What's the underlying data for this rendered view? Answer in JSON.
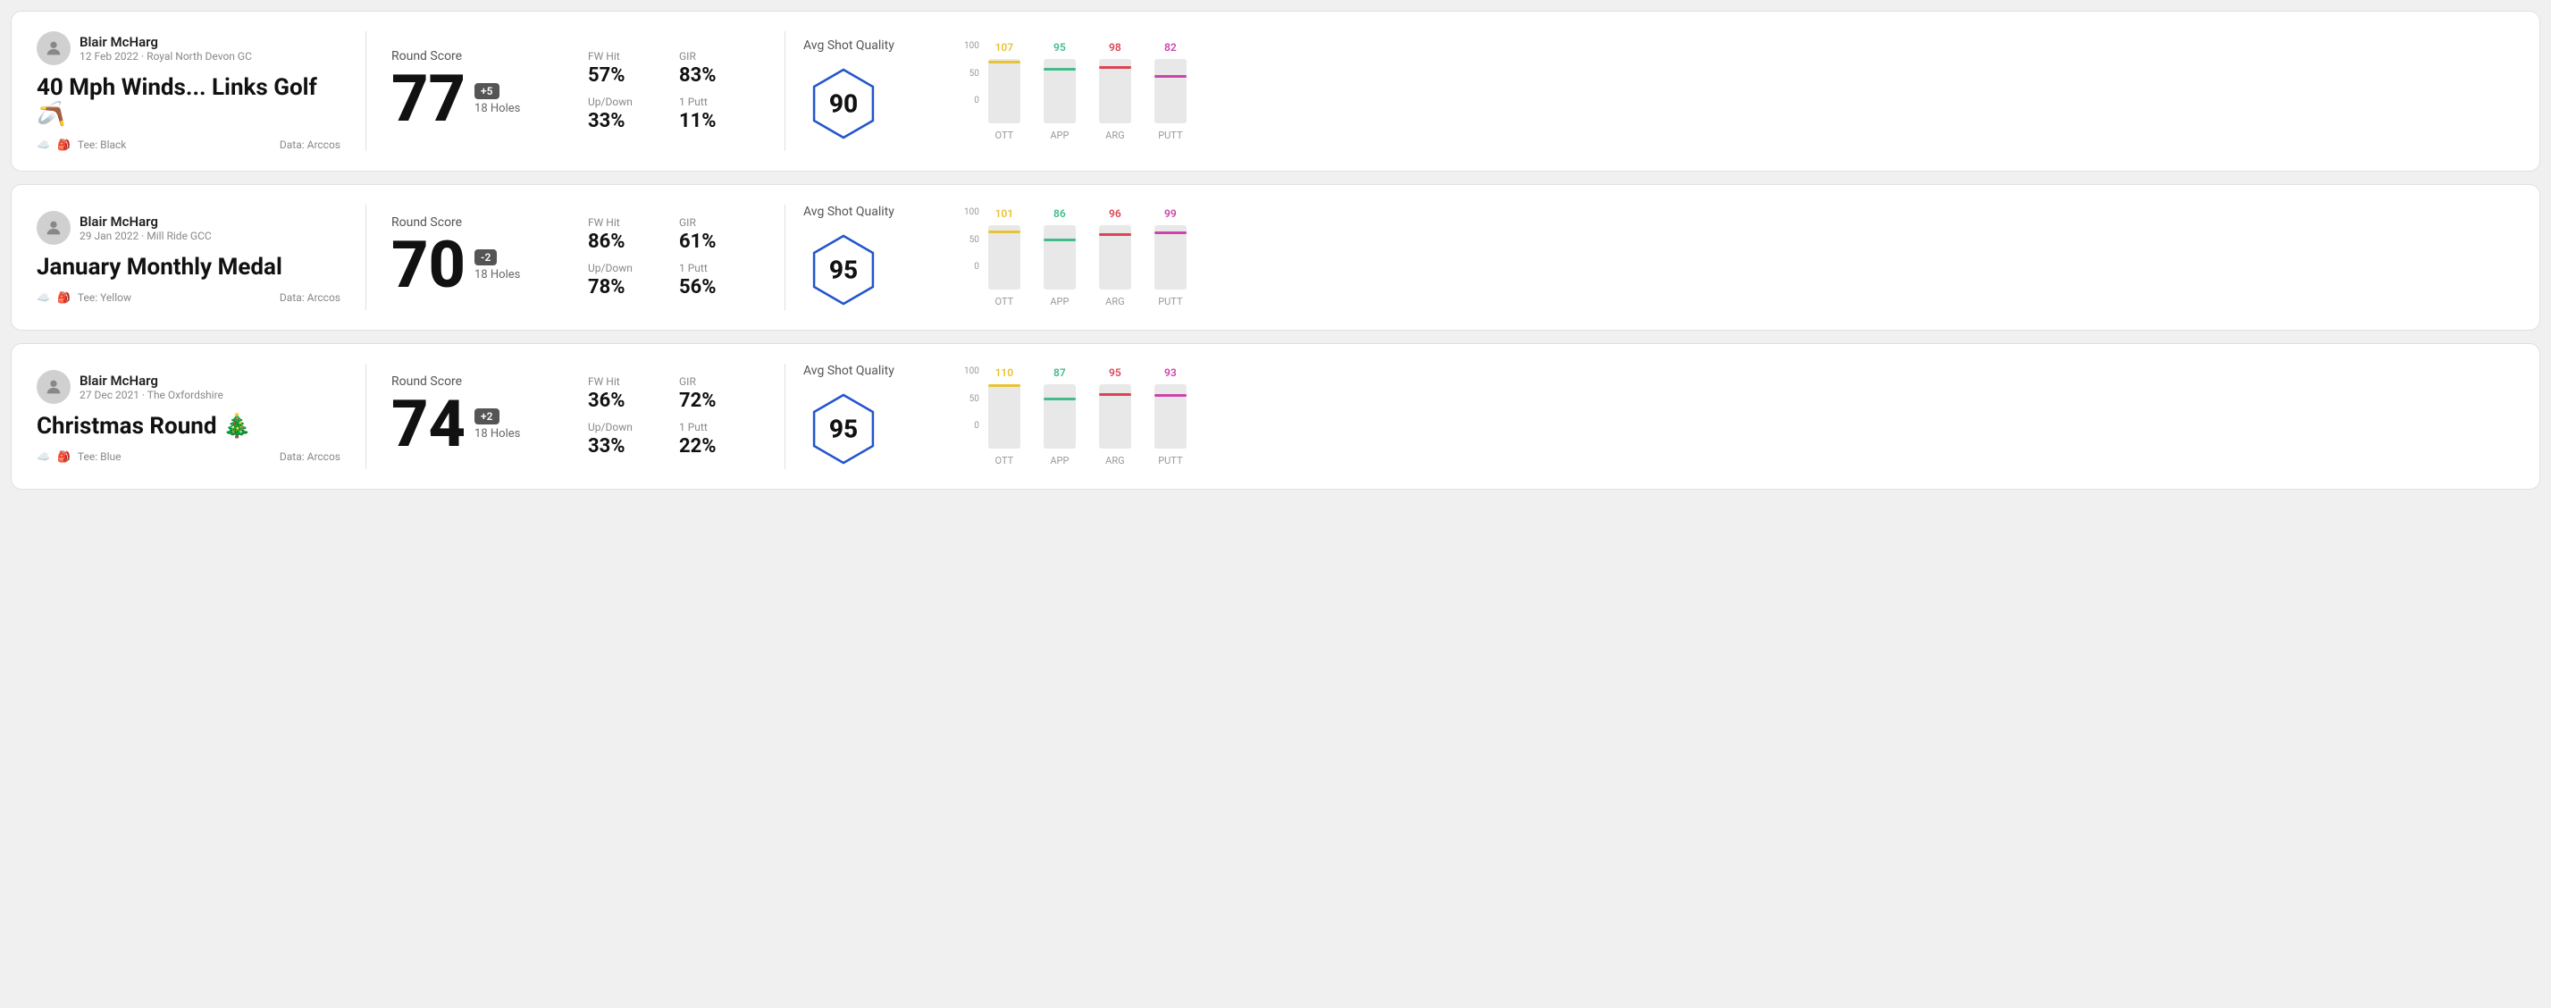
{
  "rounds": [
    {
      "id": "round-1",
      "user": {
        "name": "Blair McHarg",
        "date": "12 Feb 2022",
        "course": "Royal North Devon GC"
      },
      "title": "40 Mph Winds... Links Golf 🪃",
      "tee": "Black",
      "data_source": "Arccos",
      "score": "77",
      "score_diff": "+5",
      "holes": "18 Holes",
      "fw_hit": "57%",
      "gir": "83%",
      "up_down": "33%",
      "one_putt": "11%",
      "avg_shot_quality": "90",
      "chart": {
        "ott": {
          "value": 107,
          "color": "#e8c333"
        },
        "app": {
          "value": 95,
          "color": "#44bb88"
        },
        "arg": {
          "value": 98,
          "color": "#dd4455"
        },
        "putt": {
          "value": 82,
          "color": "#cc44aa"
        }
      }
    },
    {
      "id": "round-2",
      "user": {
        "name": "Blair McHarg",
        "date": "29 Jan 2022",
        "course": "Mill Ride GCC"
      },
      "title": "January Monthly Medal",
      "tee": "Yellow",
      "data_source": "Arccos",
      "score": "70",
      "score_diff": "-2",
      "holes": "18 Holes",
      "fw_hit": "86%",
      "gir": "61%",
      "up_down": "78%",
      "one_putt": "56%",
      "avg_shot_quality": "95",
      "chart": {
        "ott": {
          "value": 101,
          "color": "#e8c333"
        },
        "app": {
          "value": 86,
          "color": "#44bb88"
        },
        "arg": {
          "value": 96,
          "color": "#dd4455"
        },
        "putt": {
          "value": 99,
          "color": "#cc44aa"
        }
      }
    },
    {
      "id": "round-3",
      "user": {
        "name": "Blair McHarg",
        "date": "27 Dec 2021",
        "course": "The Oxfordshire"
      },
      "title": "Christmas Round 🎄",
      "tee": "Blue",
      "data_source": "Arccos",
      "score": "74",
      "score_diff": "+2",
      "holes": "18 Holes",
      "fw_hit": "36%",
      "gir": "72%",
      "up_down": "33%",
      "one_putt": "22%",
      "avg_shot_quality": "95",
      "chart": {
        "ott": {
          "value": 110,
          "color": "#e8c333"
        },
        "app": {
          "value": 87,
          "color": "#44bb88"
        },
        "arg": {
          "value": 95,
          "color": "#dd4455"
        },
        "putt": {
          "value": 93,
          "color": "#cc44aa"
        }
      }
    }
  ],
  "labels": {
    "round_score": "Round Score",
    "avg_shot_quality": "Avg Shot Quality",
    "fw_hit": "FW Hit",
    "gir": "GIR",
    "up_down": "Up/Down",
    "one_putt": "1 Putt",
    "ott": "OTT",
    "app": "APP",
    "arg": "ARG",
    "putt": "PUTT",
    "tee_prefix": "Tee:",
    "data_prefix": "Data:",
    "axis_100": "100",
    "axis_50": "50",
    "axis_0": "0"
  }
}
